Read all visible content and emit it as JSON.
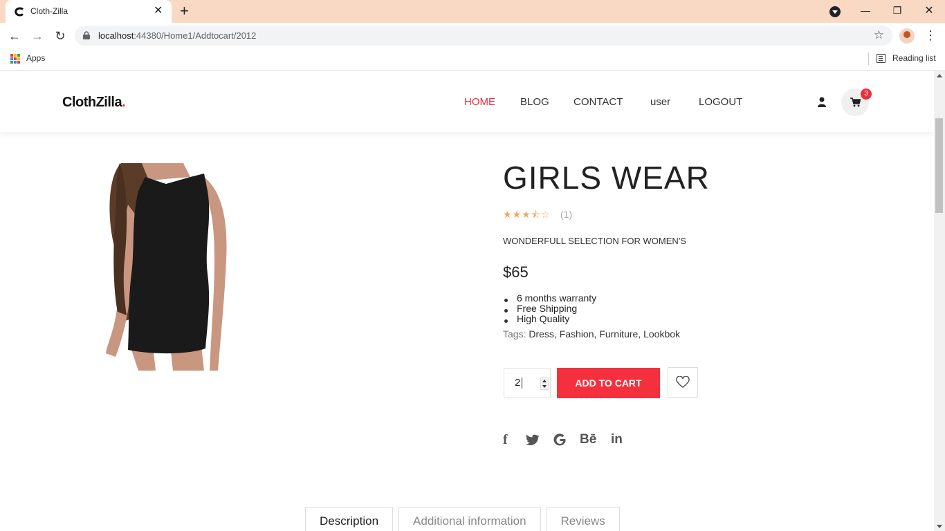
{
  "browser": {
    "tab_title": "Cloth-Zilla",
    "url_host": "localhost",
    "url_path": ":44380/Home1/Addtocart/2012",
    "apps_label": "Apps",
    "reading_list_label": "Reading list"
  },
  "header": {
    "logo_text": "ClothZilla",
    "logo_dot": ".",
    "nav": [
      "HOME",
      "BLOG",
      "CONTACT",
      "user",
      "LOGOUT"
    ],
    "active_nav": "HOME",
    "cart_count": "3"
  },
  "product": {
    "title": "GIRLS WEAR",
    "rating": 3.5,
    "rating_count": "(1)",
    "subtitle": "WONDERFULL SELECTION FOR WOMEN'S",
    "price": "$65",
    "features": [
      "6 months warranty",
      "Free Shipping",
      "High Quality"
    ],
    "tags_label": "Tags:",
    "tags": "Dress, Fashion, Furniture, Lookbok",
    "quantity": "2",
    "add_to_cart_label": "ADD TO CART"
  },
  "social": {
    "facebook": "f",
    "behance": "Bē",
    "linkedin": "in"
  },
  "product_tabs": [
    "Description",
    "Additional information",
    "Reviews"
  ],
  "colors": {
    "accent": "#f5303e",
    "star": "#f5a55a",
    "tabbar": "#fad9c4"
  }
}
